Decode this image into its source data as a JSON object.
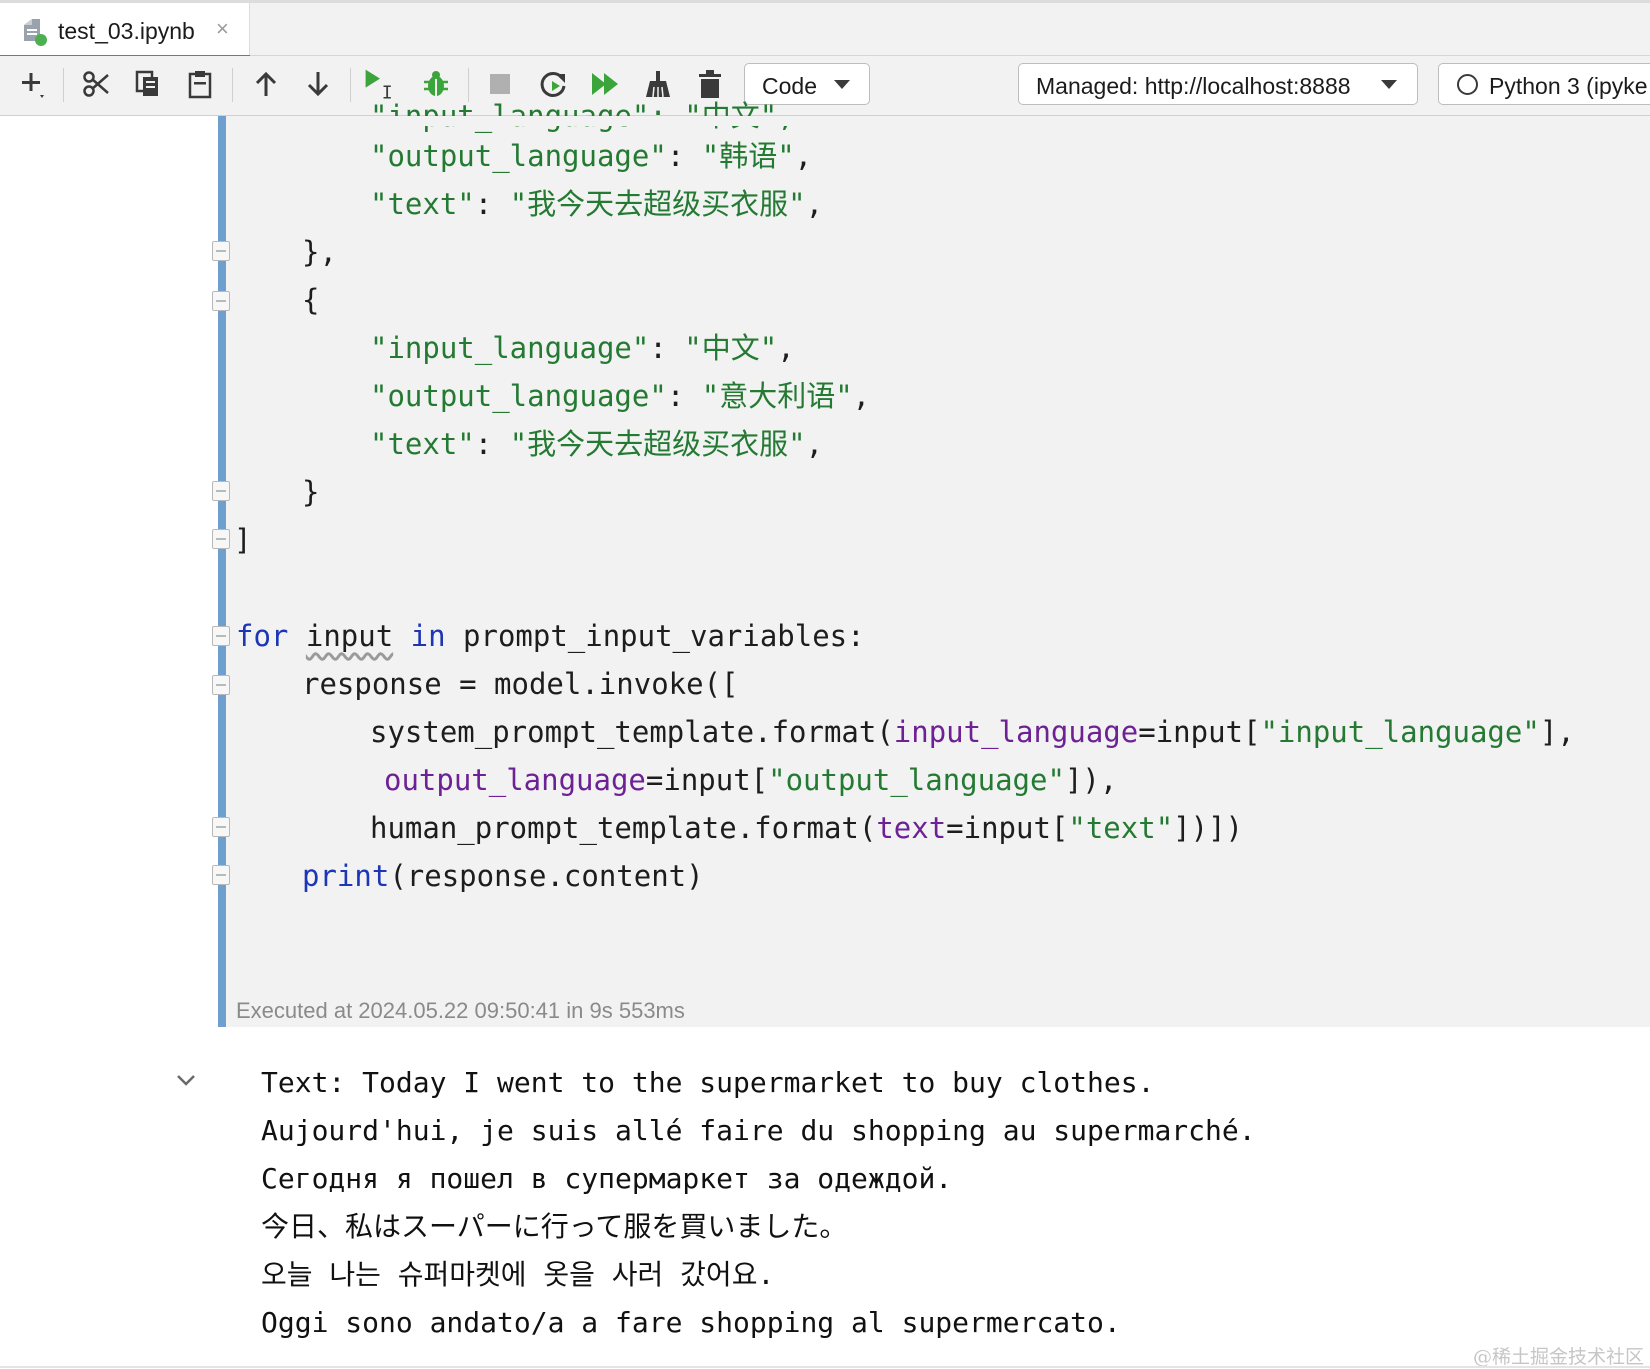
{
  "tab": {
    "title": "test_03.ipynb",
    "close_glyph": "×",
    "icon": "jupyter-notebook-icon"
  },
  "toolbar": {
    "buttons": [
      {
        "name": "add-cell",
        "icon": "plus-icon"
      },
      {
        "name": "cut-cell",
        "icon": "scissors-icon"
      },
      {
        "name": "copy-cell",
        "icon": "copy-icon"
      },
      {
        "name": "paste-cell",
        "icon": "clipboard-icon"
      },
      {
        "name": "move-up",
        "icon": "arrow-up-icon"
      },
      {
        "name": "move-down",
        "icon": "arrow-down-icon"
      },
      {
        "name": "run-cell",
        "icon": "run-icon"
      },
      {
        "name": "debug-cell",
        "icon": "bug-icon"
      },
      {
        "name": "stop",
        "icon": "stop-icon"
      },
      {
        "name": "restart",
        "icon": "restart-icon"
      },
      {
        "name": "run-all",
        "icon": "run-all-icon"
      },
      {
        "name": "clear-outputs",
        "icon": "broom-icon"
      },
      {
        "name": "delete-cell",
        "icon": "trash-icon"
      }
    ],
    "cell_type": "Code",
    "server": "Managed: http://localhost:8888",
    "kernel": "Python 3 (ipyke"
  },
  "code": {
    "line_cut": "\"input_language\": \"中文\",",
    "l1_key": "\"output_language\"",
    "l1_val": "\"韩语\"",
    "l2_key": "\"text\"",
    "l2_val": "\"我今天去超级买衣服\"",
    "l3": "},",
    "l4": "{",
    "l5_key": "\"input_language\"",
    "l5_val": "\"中文\"",
    "l6_key": "\"output_language\"",
    "l6_val": "\"意大利语\"",
    "l7_key": "\"text\"",
    "l7_val": "\"我今天去超级买衣服\"",
    "l8": "}",
    "l9": "]",
    "l10_kw1": "for",
    "l10_var": "input",
    "l10_kw2": "in",
    "l10_rest": "prompt_input_variables:",
    "l11": "response = model.invoke([",
    "l12_a": "system_prompt_template.format(",
    "l12_param": "input_language",
    "l12_b": "=input[",
    "l12_str": "\"input_language\"",
    "l12_c": "],",
    "l13_param": "output_language",
    "l13_b": "=input[",
    "l13_str": "\"output_language\"",
    "l13_c": "]),",
    "l14_a": "human_prompt_template.format(",
    "l14_param": "text",
    "l14_b": "=input[",
    "l14_str": "\"text\"",
    "l14_c": "])])",
    "l15_fn": "print",
    "l15_rest": "(response.content)"
  },
  "execution_info": "Executed at 2024.05.22 09:50:41 in 9s 553ms",
  "output": {
    "lines": [
      "Text: Today I went to the supermarket to buy clothes.",
      "Aujourd'hui, je suis allé faire du shopping au supermarché.",
      "Сегодня я пошел в супермаркет за одеждой.",
      "今日、私はスーパーに行って服を買いました。",
      "오늘 나는 슈퍼마켓에 옷을 사러 갔어요.",
      "Oggi sono andato/a a fare shopping al supermercato."
    ]
  },
  "watermark": "@稀土掘金技术社区",
  "colors": {
    "accent": "#3f7ee8",
    "cell_bar": "#6e9fce",
    "string": "#247a32",
    "keyword": "#1d36b6",
    "param": "#6d2194"
  }
}
